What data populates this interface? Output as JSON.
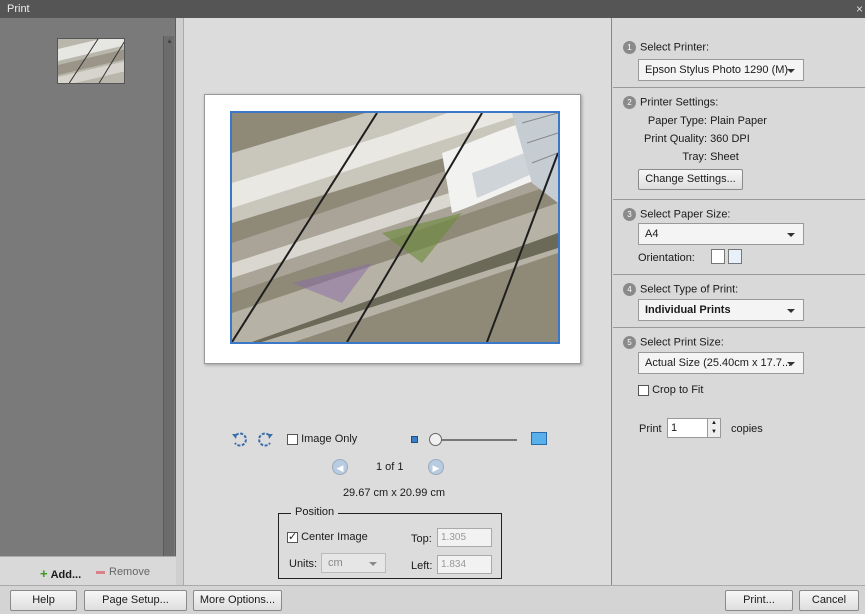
{
  "window": {
    "title": "Print"
  },
  "left_panel": {
    "add_label": "Add...",
    "remove_label": "Remove"
  },
  "preview": {
    "image_only_label": "Image Only",
    "page_indicator": "1 of 1",
    "dimensions": "29.67 cm x 20.99 cm",
    "position": {
      "legend": "Position",
      "center_image_label": "Center Image",
      "center_image_checked": true,
      "top_label": "Top:",
      "top_value": "1.305",
      "units_label": "Units:",
      "units_value": "cm",
      "left_label": "Left:",
      "left_value": "1.834"
    }
  },
  "settings": {
    "step1": {
      "num": "1",
      "title": "Select Printer:",
      "printer": "Epson Stylus Photo 1290 (M)"
    },
    "step2": {
      "num": "2",
      "title": "Printer Settings:",
      "paper_type_label": "Paper Type:",
      "paper_type_value": "Plain Paper",
      "print_quality_label": "Print Quality:",
      "print_quality_value": "360 DPI",
      "tray_label": "Tray:",
      "tray_value": "Sheet",
      "change_button": "Change Settings..."
    },
    "step3": {
      "num": "3",
      "title": "Select Paper Size:",
      "paper_size": "A4",
      "orientation_label": "Orientation:"
    },
    "step4": {
      "num": "4",
      "title": "Select Type of Print:",
      "print_type": "Individual Prints"
    },
    "step5": {
      "num": "5",
      "title": "Select Print Size:",
      "print_size": "Actual Size (25.40cm x 17.7...",
      "crop_label": "Crop to Fit",
      "print_label": "Print",
      "copies_value": "1",
      "copies_label": "copies"
    }
  },
  "footer": {
    "help": "Help",
    "page_setup": "Page Setup...",
    "more_options": "More Options...",
    "print": "Print...",
    "cancel": "Cancel"
  },
  "colors": {
    "selection_border": "#3b78c8",
    "add_green": "#3a9a1a",
    "remove_pink": "#d9828a"
  }
}
